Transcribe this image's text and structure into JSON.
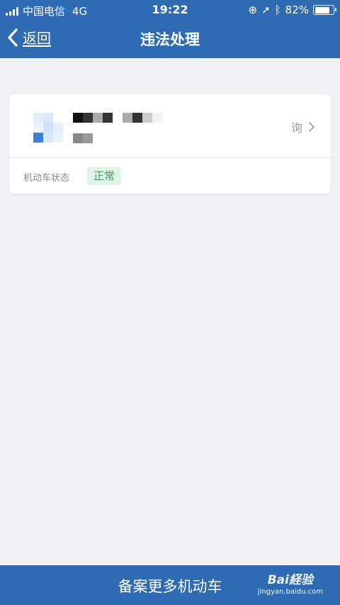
{
  "statusbar": {
    "carrier": "中国电信",
    "network": "4G",
    "time": "19:22",
    "battery": "82%",
    "battery_level": 0.82
  },
  "navbar": {
    "back_label": "返回",
    "title": "违法处理"
  },
  "card": {
    "query_label": "询",
    "status_label": "机动车状态",
    "status_value": "正常"
  },
  "bottom": {
    "button_label": "备案更多机动车"
  },
  "watermark": {
    "logo_text": "Bai経验",
    "url": "jingyan.baidu.com"
  },
  "colors": {
    "brand": "#2e6bb3",
    "status_green": "#2aa860",
    "status_bg": "#dff3e8",
    "background": "#f0f0f5"
  }
}
